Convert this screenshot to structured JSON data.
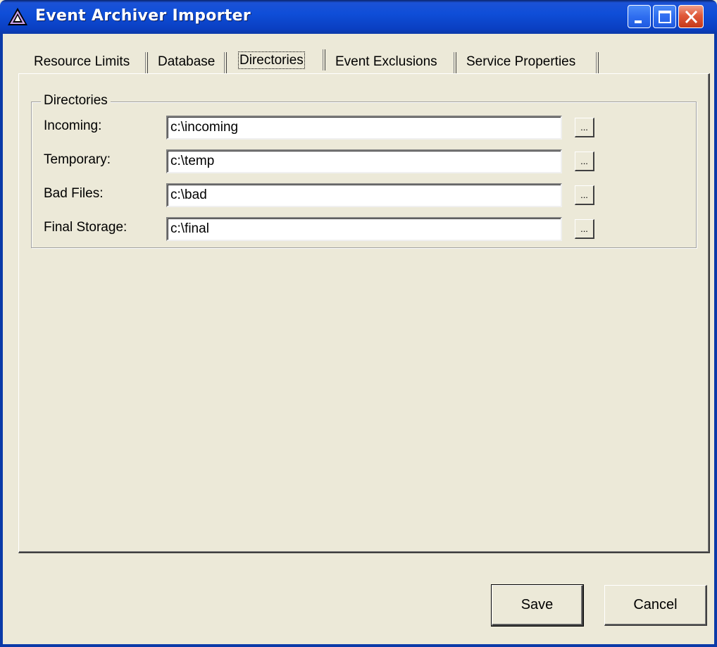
{
  "window": {
    "title": "Event Archiver Importer"
  },
  "tabs": [
    {
      "label": "Resource Limits",
      "active": false
    },
    {
      "label": "Database",
      "active": false
    },
    {
      "label": "Directories",
      "active": true
    },
    {
      "label": "Event Exclusions",
      "active": false
    },
    {
      "label": "Service Properties",
      "active": false
    }
  ],
  "directories": {
    "group_label": "Directories",
    "fields": [
      {
        "label": "Incoming:",
        "value": "c:\\incoming",
        "browse_label": "..."
      },
      {
        "label": "Temporary:",
        "value": "c:\\temp",
        "browse_label": "..."
      },
      {
        "label": "Bad Files:",
        "value": "c:\\bad",
        "browse_label": "..."
      },
      {
        "label": "Final Storage:",
        "value": "c:\\final",
        "browse_label": "..."
      }
    ]
  },
  "buttons": {
    "save_label": "Save",
    "cancel_label": "Cancel"
  },
  "colors": {
    "titlebar": "#0a3fc2",
    "window_bg": "#ece9d8",
    "close_button": "#e05a3a"
  }
}
